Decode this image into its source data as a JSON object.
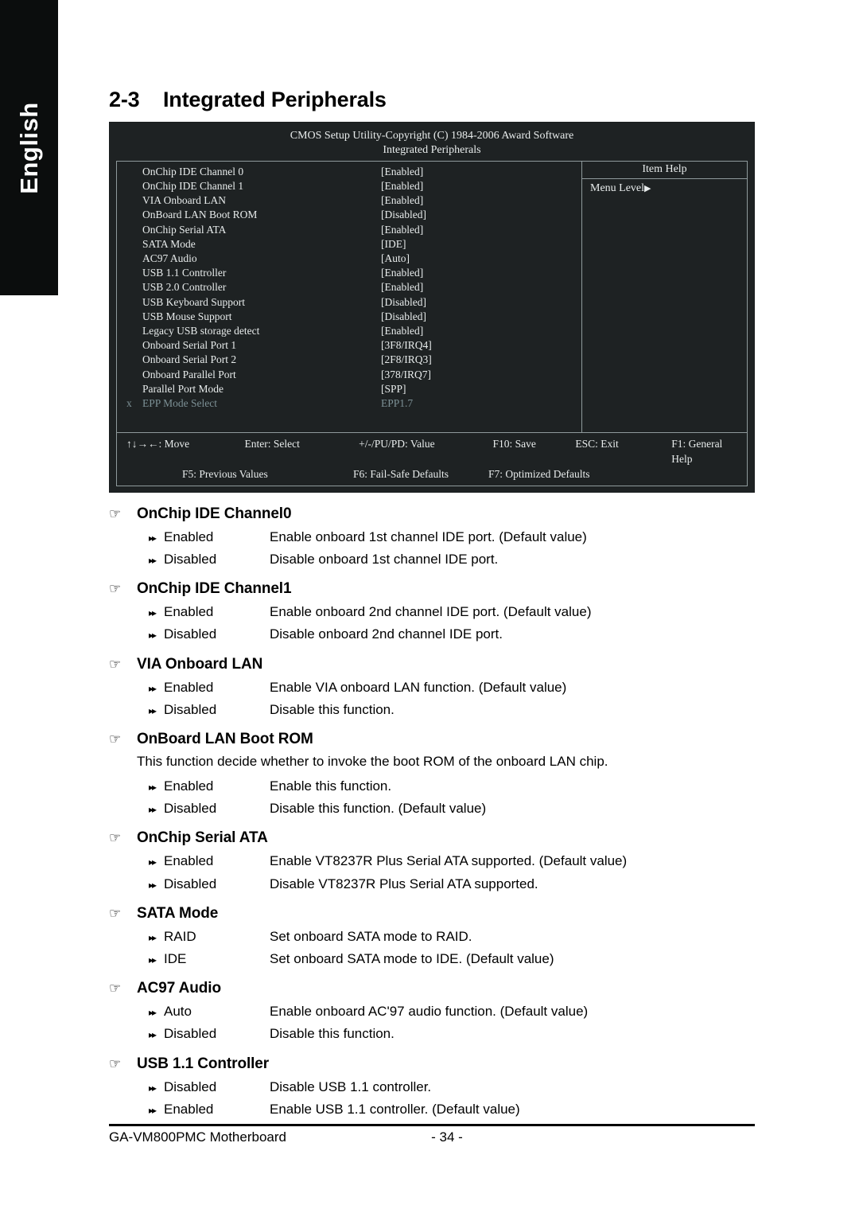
{
  "sidebar": {
    "language_tab": "English"
  },
  "heading": {
    "number": "2-3",
    "title": "Integrated Peripherals"
  },
  "bios": {
    "title_line1": "CMOS Setup Utility-Copyright (C) 1984-2006 Award Software",
    "title_line2": "Integrated Peripherals",
    "help_title": "Item Help",
    "menu_level": "Menu Level",
    "menu_level_caret": "▶",
    "rows": [
      {
        "mark": "",
        "name": "OnChip IDE Channel 0",
        "value": "[Enabled]",
        "dim": false
      },
      {
        "mark": "",
        "name": "OnChip IDE Channel 1",
        "value": "[Enabled]",
        "dim": false
      },
      {
        "mark": "",
        "name": "VIA Onboard LAN",
        "value": "[Enabled]",
        "dim": false
      },
      {
        "mark": "",
        "name": "OnBoard LAN Boot ROM",
        "value": "[Disabled]",
        "dim": false
      },
      {
        "mark": "",
        "name": "OnChip Serial ATA",
        "value": "[Enabled]",
        "dim": false
      },
      {
        "mark": "",
        "name": "SATA Mode",
        "value": "[IDE]",
        "dim": false
      },
      {
        "mark": "",
        "name": "AC97 Audio",
        "value": "[Auto]",
        "dim": false
      },
      {
        "mark": "",
        "name": "USB 1.1 Controller",
        "value": "[Enabled]",
        "dim": false
      },
      {
        "mark": "",
        "name": "USB 2.0 Controller",
        "value": "[Enabled]",
        "dim": false
      },
      {
        "mark": "",
        "name": "USB Keyboard Support",
        "value": "[Disabled]",
        "dim": false
      },
      {
        "mark": "",
        "name": "USB Mouse Support",
        "value": "[Disabled]",
        "dim": false
      },
      {
        "mark": "",
        "name": "Legacy USB storage detect",
        "value": "[Enabled]",
        "dim": false
      },
      {
        "mark": "",
        "name": "Onboard Serial Port 1",
        "value": "[3F8/IRQ4]",
        "dim": false
      },
      {
        "mark": "",
        "name": "Onboard Serial Port 2",
        "value": "[2F8/IRQ3]",
        "dim": false
      },
      {
        "mark": "",
        "name": "Onboard Parallel Port",
        "value": "[378/IRQ7]",
        "dim": false
      },
      {
        "mark": "",
        "name": "Parallel Port Mode",
        "value": "[SPP]",
        "dim": false
      },
      {
        "mark": "x",
        "name": "EPP Mode Select",
        "value": "EPP1.7",
        "dim": true
      }
    ],
    "keys_line1": {
      "move": "↑↓→←: Move",
      "enter": "Enter: Select",
      "value": "+/-/PU/PD: Value",
      "save": "F10: Save",
      "exit": "ESC: Exit",
      "help": "F1: General Help"
    },
    "keys_line2": {
      "previous": "F5: Previous Values",
      "failsafe": "F6: Fail-Safe Defaults",
      "optimized": "F7: Optimized Defaults"
    }
  },
  "icons": {
    "hand": "☞",
    "option_bullet": "▸▸"
  },
  "sections": [
    {
      "title": "OnChip IDE Channel0",
      "note": "",
      "options": [
        {
          "name": "Enabled",
          "desc": "Enable onboard 1st channel IDE port. (Default value)"
        },
        {
          "name": "Disabled",
          "desc": "Disable onboard 1st channel IDE port."
        }
      ]
    },
    {
      "title": "OnChip IDE Channel1",
      "note": "",
      "options": [
        {
          "name": "Enabled",
          "desc": "Enable onboard 2nd channel IDE port. (Default value)"
        },
        {
          "name": "Disabled",
          "desc": "Disable onboard 2nd channel IDE port."
        }
      ]
    },
    {
      "title": "VIA Onboard LAN",
      "note": "",
      "options": [
        {
          "name": "Enabled",
          "desc": "Enable VIA onboard LAN function. (Default value)"
        },
        {
          "name": "Disabled",
          "desc": "Disable this function."
        }
      ]
    },
    {
      "title": "OnBoard LAN Boot ROM",
      "note": "This function decide whether to invoke the boot ROM of the onboard LAN chip.",
      "options": [
        {
          "name": "Enabled",
          "desc": "Enable this function."
        },
        {
          "name": "Disabled",
          "desc": "Disable this function. (Default value)"
        }
      ]
    },
    {
      "title": "OnChip Serial ATA",
      "note": "",
      "options": [
        {
          "name": "Enabled",
          "desc": "Enable VT8237R Plus Serial ATA supported. (Default value)"
        },
        {
          "name": "Disabled",
          "desc": "Disable VT8237R Plus Serial ATA supported."
        }
      ]
    },
    {
      "title": "SATA Mode",
      "note": "",
      "options": [
        {
          "name": "RAID",
          "desc": "Set onboard SATA mode to RAID."
        },
        {
          "name": "IDE",
          "desc": "Set onboard SATA mode to IDE. (Default value)"
        }
      ]
    },
    {
      "title": "AC97 Audio",
      "note": "",
      "options": [
        {
          "name": "Auto",
          "desc": "Enable onboard AC'97 audio function. (Default value)"
        },
        {
          "name": "Disabled",
          "desc": "Disable this function."
        }
      ]
    },
    {
      "title": "USB 1.1 Controller",
      "note": "",
      "options": [
        {
          "name": "Disabled",
          "desc": "Disable USB 1.1 controller."
        },
        {
          "name": "Enabled",
          "desc": "Enable USB 1.1 controller. (Default value)"
        }
      ]
    }
  ],
  "footer": {
    "product": "GA-VM800PMC Motherboard",
    "page": "- 34 -"
  }
}
